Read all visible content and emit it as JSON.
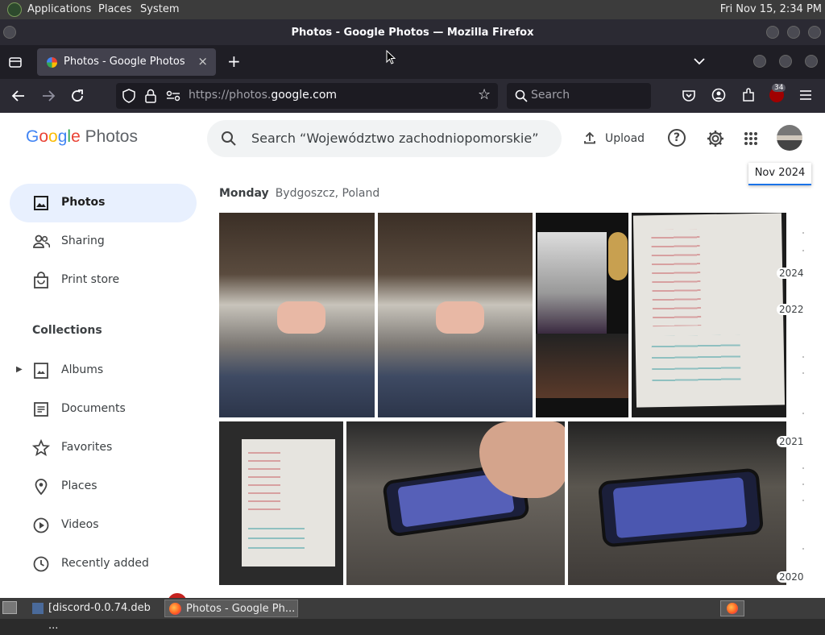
{
  "topbar": {
    "menus": [
      "Applications",
      "Places",
      "System"
    ],
    "clock": "Fri Nov 15,  2:34 PM"
  },
  "window": {
    "title": "Photos - Google Photos — Mozilla Firefox"
  },
  "tab": {
    "label": "Photos - Google Photos",
    "close": "×",
    "new_tab": "+"
  },
  "navbar": {
    "url_prefix": "https://photos.",
    "url_domain": "google.com",
    "search_placeholder": "Search",
    "extension_badge": "34"
  },
  "app": {
    "logo_google": [
      "G",
      "o",
      "o",
      "g",
      "l",
      "e"
    ],
    "logo_photos": "Photos",
    "search_placeholder": "Search “Województwo zachodniopomorskie”",
    "upload_label": "Upload"
  },
  "sidebar": {
    "items": [
      {
        "label": "Photos",
        "icon": "photo-icon",
        "active": true
      },
      {
        "label": "Sharing",
        "icon": "people-icon"
      },
      {
        "label": "Print store",
        "icon": "bag-icon"
      }
    ],
    "collections_heading": "Collections",
    "collections": [
      {
        "label": "Albums",
        "icon": "album-icon"
      },
      {
        "label": "Documents",
        "icon": "document-icon"
      },
      {
        "label": "Favorites",
        "icon": "star-icon"
      },
      {
        "label": "Places",
        "icon": "pin-icon"
      },
      {
        "label": "Videos",
        "icon": "play-circle-icon"
      },
      {
        "label": "Recently added",
        "icon": "clock-icon"
      }
    ]
  },
  "content": {
    "date_tooltip": "Nov 2024",
    "day": "Monday",
    "location": "Bydgoszcz, Poland",
    "timeline_years": [
      "2024",
      "2022",
      "2021",
      "2020"
    ]
  },
  "taskbar": {
    "tasks": [
      {
        "label": "[discord-0.0.74.deb ..."
      },
      {
        "label": "Photos - Google Ph...",
        "active": true
      }
    ]
  },
  "colors": {
    "accent": "#1a73e8",
    "active_nav_bg": "#e8f0fe",
    "firefox_dark": "#2b2a33"
  }
}
